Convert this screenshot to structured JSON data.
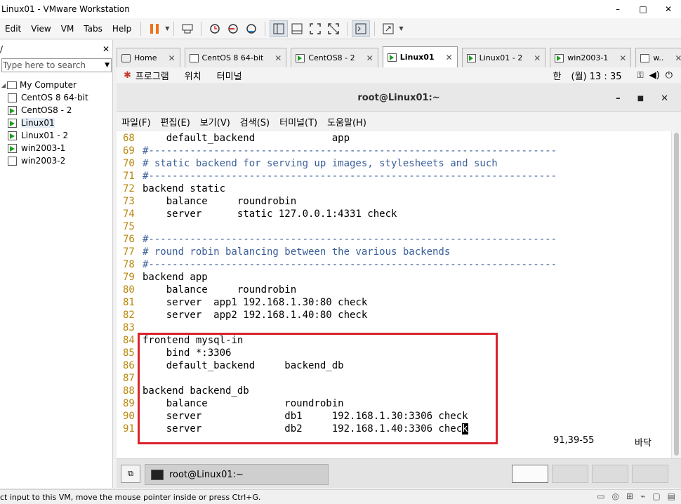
{
  "window": {
    "title": "Linux01 - VMware Workstation",
    "controls": {
      "minimize": "–",
      "maximize": "□",
      "close": "✕"
    }
  },
  "menubar": {
    "items": [
      "Edit",
      "View",
      "VM",
      "Tabs",
      "Help"
    ]
  },
  "library": {
    "label": "/",
    "close": "✕",
    "search_placeholder": "Type here to search",
    "root": "My Computer",
    "vms": [
      {
        "name": "CentOS 8 64-bit",
        "running": false
      },
      {
        "name": "CentOS8 - 2",
        "running": true
      },
      {
        "name": "Linux01",
        "running": true,
        "selected": true
      },
      {
        "name": "Linux01 - 2",
        "running": true
      },
      {
        "name": "win2003-1",
        "running": true
      },
      {
        "name": "win2003-2",
        "running": false
      }
    ]
  },
  "tabs": [
    {
      "label": "Home",
      "icon": "home-icon"
    },
    {
      "label": "CentOS 8 64-bit",
      "icon": "vm-icon"
    },
    {
      "label": "CentOS8 - 2",
      "icon": "vm-running-icon"
    },
    {
      "label": "Linux01",
      "icon": "vm-running-icon",
      "active": true
    },
    {
      "label": "Linux01 - 2",
      "icon": "vm-running-icon"
    },
    {
      "label": "win2003-1",
      "icon": "vm-running-icon"
    },
    {
      "label": "w..",
      "icon": "vm-icon"
    }
  ],
  "gnome": {
    "menus": [
      "프로그램",
      "위치",
      "터미널"
    ],
    "input_method": "한",
    "clock": "(월) 13 : 35"
  },
  "terminal": {
    "title": "root@Linux01:~",
    "menus": [
      "파일(F)",
      "편집(E)",
      "보기(V)",
      "검색(S)",
      "터미널(T)",
      "도움말(H)"
    ],
    "lines": [
      {
        "n": "68",
        "t": "    default_backend             app",
        "c": false
      },
      {
        "n": "69",
        "t": "#---------------------------------------------------------------------",
        "c": true
      },
      {
        "n": "70",
        "t": "# static backend for serving up images, stylesheets and such",
        "c": true
      },
      {
        "n": "71",
        "t": "#---------------------------------------------------------------------",
        "c": true
      },
      {
        "n": "72",
        "t": "backend static",
        "c": false
      },
      {
        "n": "73",
        "t": "    balance     roundrobin",
        "c": false
      },
      {
        "n": "74",
        "t": "    server      static 127.0.0.1:4331 check",
        "c": false
      },
      {
        "n": "75",
        "t": "",
        "c": false
      },
      {
        "n": "76",
        "t": "#---------------------------------------------------------------------",
        "c": true
      },
      {
        "n": "77",
        "t": "# round robin balancing between the various backends",
        "c": true
      },
      {
        "n": "78",
        "t": "#---------------------------------------------------------------------",
        "c": true
      },
      {
        "n": "79",
        "t": "backend app",
        "c": false
      },
      {
        "n": "80",
        "t": "    balance     roundrobin",
        "c": false
      },
      {
        "n": "81",
        "t": "    server  app1 192.168.1.30:80 check",
        "c": false
      },
      {
        "n": "82",
        "t": "    server  app2 192.168.1.40:80 check",
        "c": false
      },
      {
        "n": "83",
        "t": "",
        "c": false
      },
      {
        "n": "84",
        "t": "frontend mysql-in",
        "c": false
      },
      {
        "n": "85",
        "t": "    bind *:3306",
        "c": false
      },
      {
        "n": "86",
        "t": "    default_backend     backend_db",
        "c": false
      },
      {
        "n": "87",
        "t": "",
        "c": false
      },
      {
        "n": "88",
        "t": "backend backend_db",
        "c": false
      },
      {
        "n": "89",
        "t": "    balance             roundrobin",
        "c": false
      },
      {
        "n": "90",
        "t": "    server              db1     192.168.1.30:3306 check",
        "c": false
      },
      {
        "n": "91",
        "t": "    server              db2     192.168.1.40:3306 chec",
        "c": false,
        "cursor": "k"
      }
    ],
    "cursor_pos": "91,39-55",
    "scroll_pos": "바닥"
  },
  "taskbar": {
    "item": "root@Linux01:~"
  },
  "statusbar": {
    "message": "ct input to this VM, move the mouse pointer inside or press Ctrl+G."
  },
  "colors": {
    "highlight_box": "#d9232b",
    "line_numbers": "#b8860b",
    "comments": "#3a5f9a",
    "pause_icon": "#f07018"
  }
}
